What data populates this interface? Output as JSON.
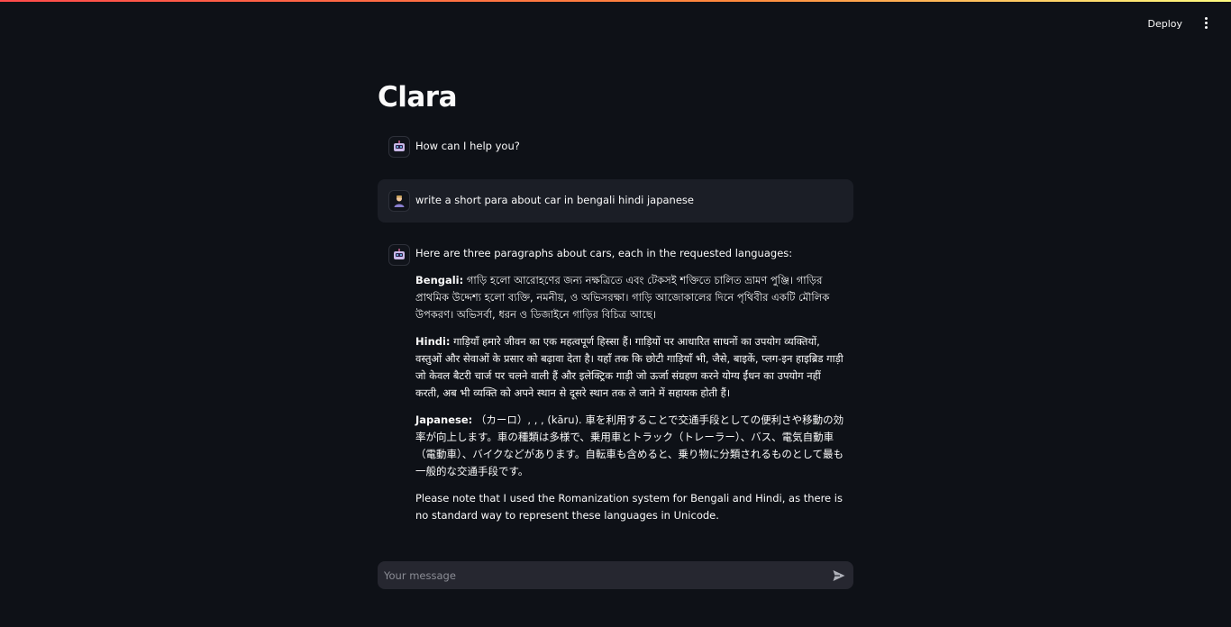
{
  "header": {
    "deploy_label": "Deploy",
    "menu_icon": "kebab-menu-icon"
  },
  "app": {
    "title": "Clara"
  },
  "messages": [
    {
      "role": "assistant",
      "avatar_icon": "robot-avatar-icon",
      "text": "How can I help you?"
    },
    {
      "role": "user",
      "avatar_icon": "user-avatar-icon",
      "text": "write a short para about car in bengali hindi japanese"
    },
    {
      "role": "assistant",
      "avatar_icon": "robot-avatar-icon",
      "intro": "Here are three paragraphs about cars, each in the requested languages:",
      "bengali_label": "Bengali:",
      "bengali_text": " গাড়ি হলো আরোহণের জন্য নক্ষত্রিতে এবং টেকসই শক্তিতে চালিত ভ্রামণ পুঞ্জি। গাড়ির প্রাথমিক উদ্দেশ্য হলো ব্যক্তি, নমনীয়, ও অভিসরক্ষা। গাড়ি আজোকালের দিনে পৃথিবীর একটি মৌলিক উপকরণ। অভিসর্বা, ধরন ও ডিজাইনে গাড়ির বিচিত্র আছে।",
      "hindi_label": "Hindi:",
      "hindi_text": " गाड़ियाँ हमारे जीवन का एक महत्वपूर्ण हिस्सा हैं। गाड़ियों पर आधारित साधनों का उपयोग व्यक्तियों, वस्तुओं और सेवाओं के प्रसार को बढ़ावा देता है। यहाँ तक कि छोटी गाड़ियाँ भी, जैसे, बाइकें, प्लग-इन हाइब्रिड गाड़ी जो केवल बैटरी चार्ज पर चलने वाली हैं और इलेक्ट्रिक गाड़ी जो ऊर्जा संग्रहण करने योग्य ईंधन का उपयोग नहीं करती, अब भी व्यक्ति को अपने स्थान से दूसरे स्थान तक ले जाने में सहायक होती हैं।",
      "japanese_label": "Japanese:",
      "japanese_text": " （カーロ）, , , (kāru). 車を利用することで交通手段としての便利さや移動の効率が向上します。車の種類は多様で、乗用車とトラック（トレーラー）、バス、電気自動車（電動車）、バイクなどがあります。自転車も含めると、乗り物に分類されるものとして最も一般的な交通手段です。",
      "note": "Please note that I used the Romanization system for Bengali and Hindi, as there is no standard way to represent these languages in Unicode."
    }
  ],
  "chat_input": {
    "placeholder": "Your message",
    "send_icon": "send-icon"
  }
}
